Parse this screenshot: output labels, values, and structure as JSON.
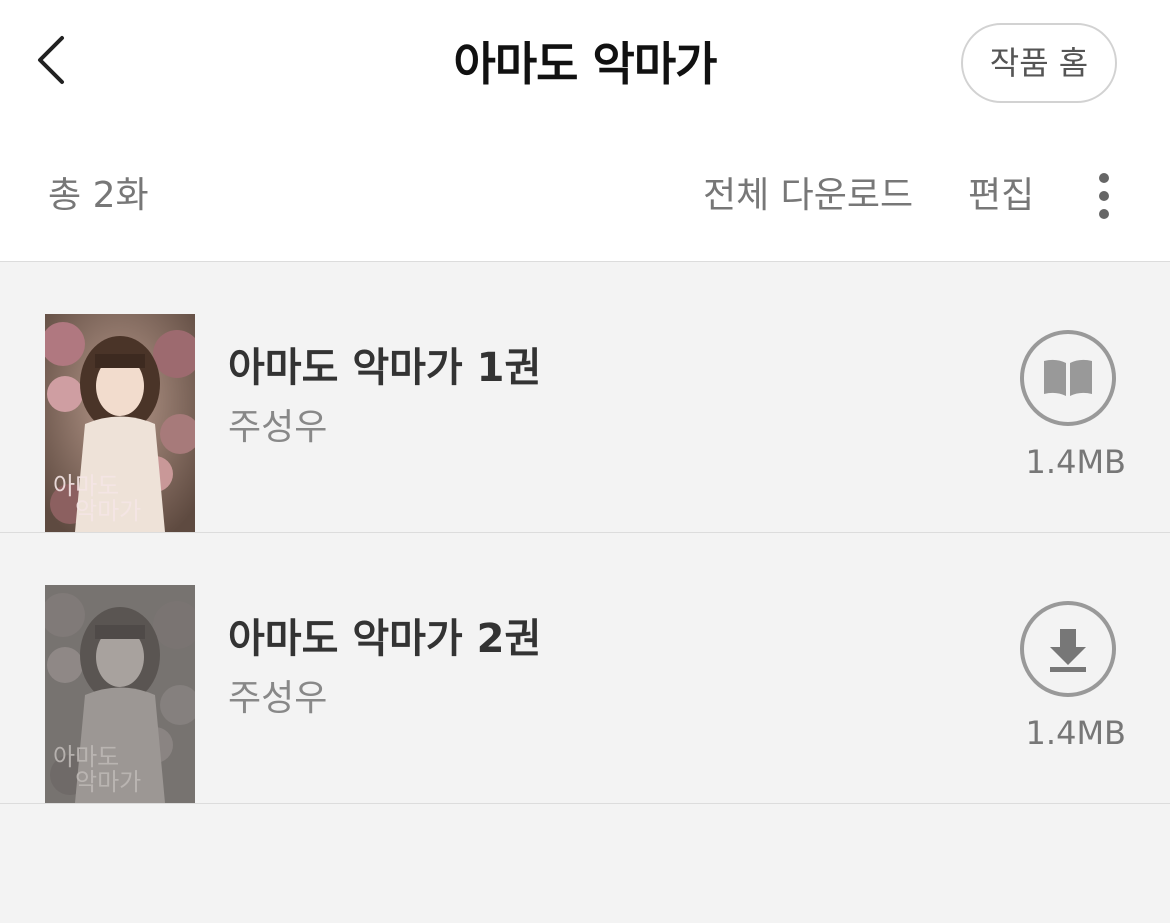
{
  "header": {
    "title": "아마도 악마가",
    "work_home_label": "작품 홈",
    "back_icon": "chevron-left-icon"
  },
  "toolbar": {
    "total_count": "총 2화",
    "download_all_label": "전체 다운로드",
    "edit_label": "편집",
    "more_icon": "more-vertical-icon"
  },
  "volumes": [
    {
      "title": "아마도 악마가 1권",
      "author": "주성우",
      "size": "1.4MB",
      "status": "downloaded",
      "action_icon": "open-book-icon",
      "cover_text": "아마도 악마가"
    },
    {
      "title": "아마도 악마가 2권",
      "author": "주성우",
      "size": "1.4MB",
      "status": "not-downloaded",
      "action_icon": "download-arrow-icon",
      "cover_text": "아마도 악마가"
    }
  ],
  "colors": {
    "header_bg": "#ffffff",
    "list_bg": "#f3f3f3",
    "icon_gray": "#999999",
    "text_dark": "#333333",
    "text_muted": "#888888"
  }
}
